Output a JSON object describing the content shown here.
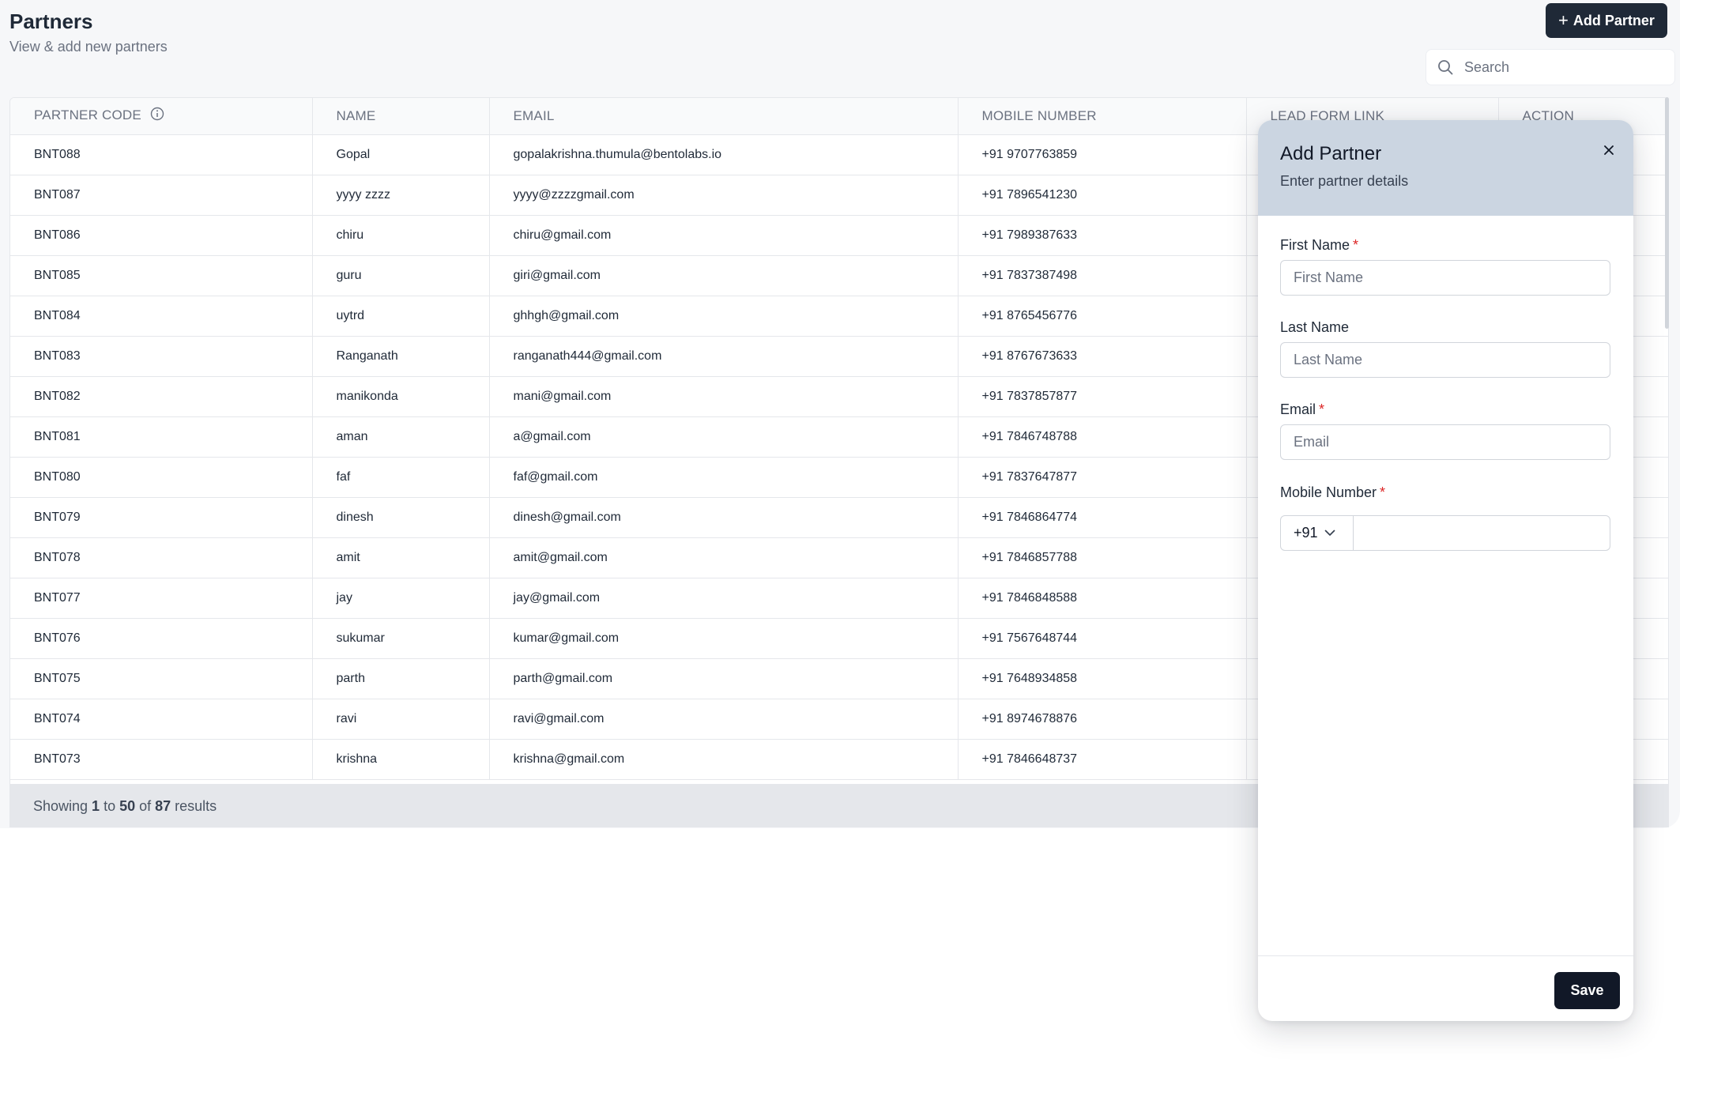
{
  "header": {
    "title": "Partners",
    "subtitle": "View & add new partners",
    "add_button_label": "Add Partner",
    "search_placeholder": "Search"
  },
  "table": {
    "columns": [
      "PARTNER CODE",
      "NAME",
      "EMAIL",
      "MOBILE NUMBER",
      "LEAD FORM LINK",
      "ACTION"
    ],
    "rows": [
      {
        "code": "BNT088",
        "name": "Gopal",
        "email": "gopalakrishna.thumula@bentolabs.io",
        "mobile": "+91 9707763859"
      },
      {
        "code": "BNT087",
        "name": "yyyy zzzz",
        "email": "yyyy@zzzzgmail.com",
        "mobile": "+91 7896541230"
      },
      {
        "code": "BNT086",
        "name": "chiru",
        "email": "chiru@gmail.com",
        "mobile": "+91 7989387633"
      },
      {
        "code": "BNT085",
        "name": "guru",
        "email": "giri@gmail.com",
        "mobile": "+91 7837387498"
      },
      {
        "code": "BNT084",
        "name": "uytrd",
        "email": "ghhgh@gmail.com",
        "mobile": "+91 8765456776"
      },
      {
        "code": "BNT083",
        "name": "Ranganath",
        "email": "ranganath444@gmail.com",
        "mobile": "+91 8767673633"
      },
      {
        "code": "BNT082",
        "name": "manikonda",
        "email": "mani@gmail.com",
        "mobile": "+91 7837857877"
      },
      {
        "code": "BNT081",
        "name": "aman",
        "email": "a@gmail.com",
        "mobile": "+91 7846748788"
      },
      {
        "code": "BNT080",
        "name": "faf",
        "email": "faf@gmail.com",
        "mobile": "+91 7837647877"
      },
      {
        "code": "BNT079",
        "name": "dinesh",
        "email": "dinesh@gmail.com",
        "mobile": "+91 7846864774"
      },
      {
        "code": "BNT078",
        "name": "amit",
        "email": "amit@gmail.com",
        "mobile": "+91 7846857788"
      },
      {
        "code": "BNT077",
        "name": "jay",
        "email": "jay@gmail.com",
        "mobile": "+91 7846848588"
      },
      {
        "code": "BNT076",
        "name": "sukumar",
        "email": "kumar@gmail.com",
        "mobile": "+91 7567648744"
      },
      {
        "code": "BNT075",
        "name": "parth",
        "email": "parth@gmail.com",
        "mobile": "+91 7648934858"
      },
      {
        "code": "BNT074",
        "name": "ravi",
        "email": "ravi@gmail.com",
        "mobile": "+91 8974678876"
      },
      {
        "code": "BNT073",
        "name": "krishna",
        "email": "krishna@gmail.com",
        "mobile": "+91 7846648737"
      }
    ]
  },
  "pagination": {
    "showing_label": "Showing",
    "from": "1",
    "to_label": "to",
    "to": "50",
    "of_label": "of",
    "total": "87",
    "results_label": "results"
  },
  "modal": {
    "title": "Add Partner",
    "subtitle": "Enter partner details",
    "first_name_label": "First Name",
    "first_name_placeholder": "First Name",
    "last_name_label": "Last Name",
    "last_name_placeholder": "Last Name",
    "email_label": "Email",
    "email_placeholder": "Email",
    "mobile_label": "Mobile Number",
    "country_code": "+91",
    "required_mark": "*",
    "save_label": "Save"
  },
  "icons": {
    "plus": "plus-icon",
    "search": "search-icon",
    "info": "info-icon",
    "close": "close-icon",
    "chevron": "chevron-down-icon"
  }
}
